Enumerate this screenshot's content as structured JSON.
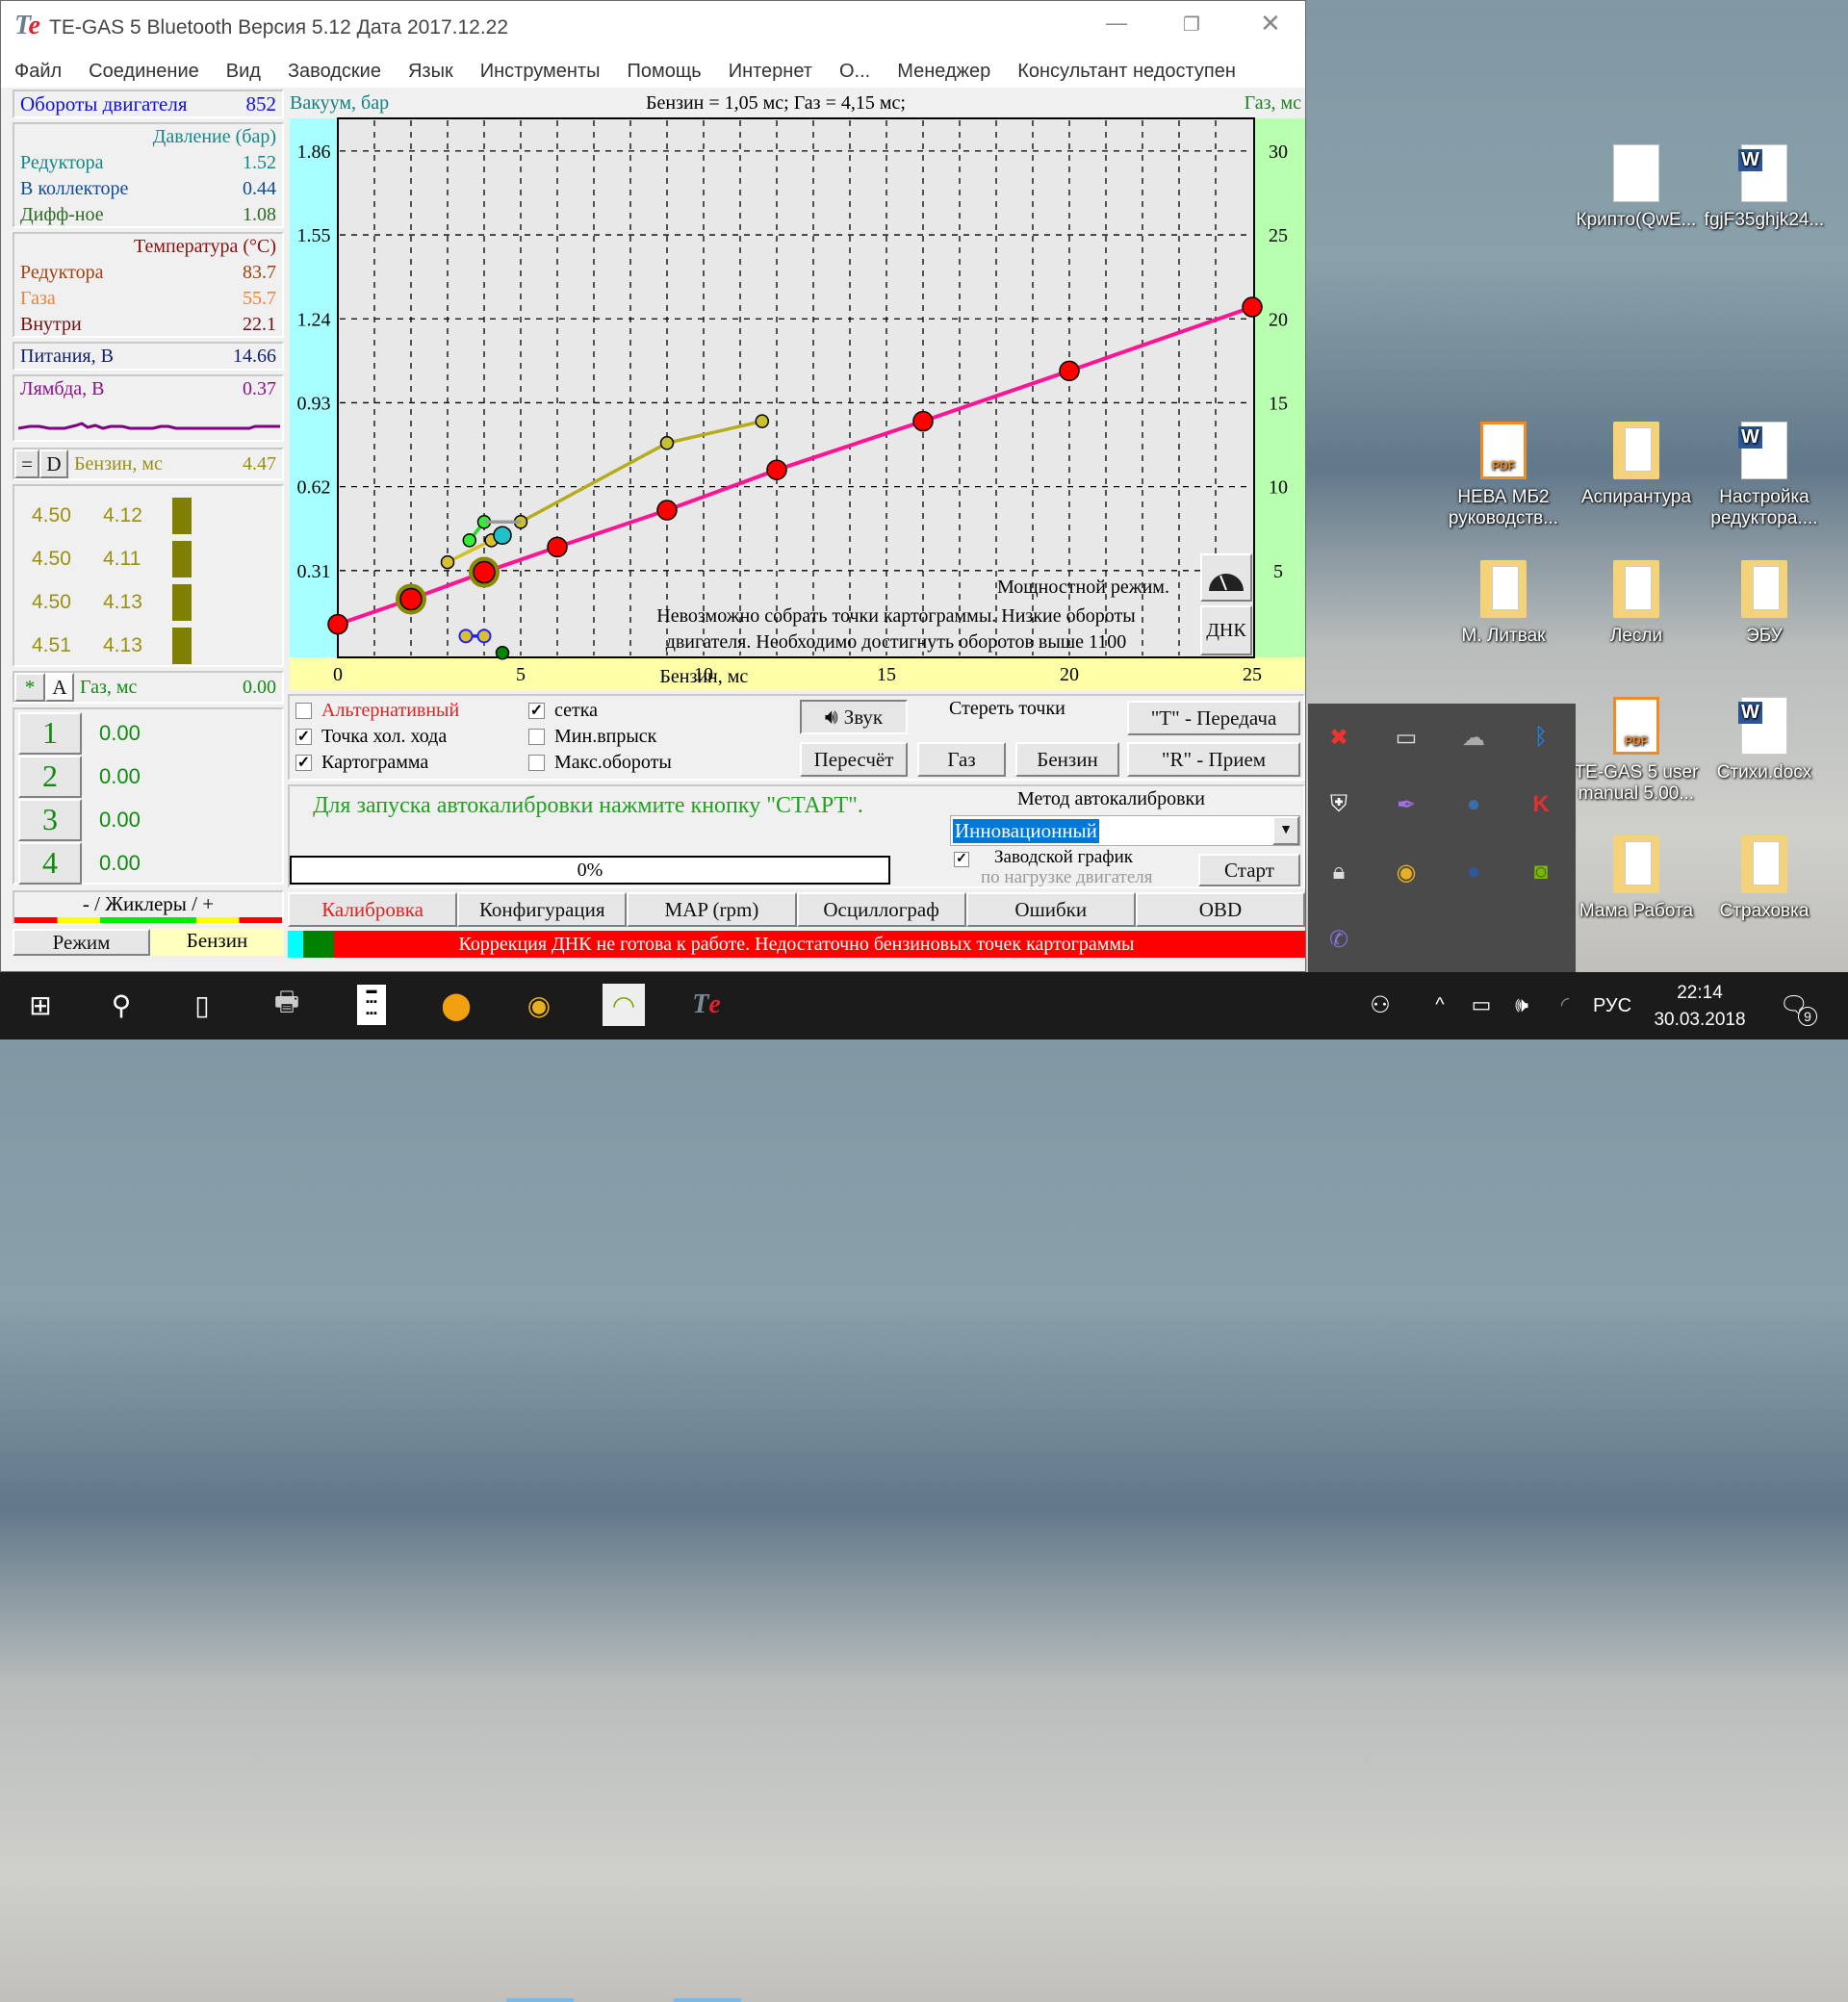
{
  "window": {
    "title": "TE-GAS 5 Bluetooth Версия 5.12  Дата 2017.12.22",
    "logo": "Te"
  },
  "menu": [
    "Файл",
    "Соединение",
    "Вид",
    "Заводские",
    "Язык",
    "Инструменты",
    "Помощь",
    "Интернет",
    "О...",
    "Менеджер",
    "Консультант недоступен"
  ],
  "left": {
    "rpm": {
      "label": "Обороты двигателя",
      "value": "852"
    },
    "pressure": {
      "title": "Давление (бар)",
      "rows": [
        {
          "label": "Редуктора",
          "value": "1.52"
        },
        {
          "label": "В коллекторе",
          "value": "0.44"
        },
        {
          "label": "Дифф-ное",
          "value": "1.08"
        }
      ]
    },
    "temperature": {
      "title": "Температура (°C)",
      "rows": [
        {
          "label": "Редуктора",
          "value": "83.7"
        },
        {
          "label": "Газа",
          "value": "55.7"
        },
        {
          "label": "Внутри",
          "value": "22.1"
        }
      ]
    },
    "supply": {
      "label": "Питания, В",
      "value": "14.66"
    },
    "lambda": {
      "label": "Лямбда, В",
      "value": "0.37"
    },
    "petrol": {
      "btn_eq": "=",
      "btn_d": "D",
      "label": "Бензин, мс",
      "value": "4.47",
      "cylinders": [
        {
          "a": "4.50",
          "b": "4.12"
        },
        {
          "a": "4.50",
          "b": "4.11"
        },
        {
          "a": "4.50",
          "b": "4.13"
        },
        {
          "a": "4.51",
          "b": "4.13"
        }
      ]
    },
    "gas": {
      "btn_star": "*",
      "btn_a": "A",
      "label": "Газ, мс",
      "value": "0.00",
      "injectors": [
        {
          "n": "1",
          "v": "0.00"
        },
        {
          "n": "2",
          "v": "0.00"
        },
        {
          "n": "3",
          "v": "0.00"
        },
        {
          "n": "4",
          "v": "0.00"
        }
      ]
    },
    "jets": "- / Жиклеры / +",
    "mode_label": "Режим",
    "mode_value": "Бензин"
  },
  "chart_data": {
    "type": "line",
    "title": "Бензин = 1,05 мс; Газ = 4,15 мс;",
    "xlabel": "Бензин, мс",
    "ylabel_left": "Вакуум, бар",
    "ylabel_right": "Газ, мс",
    "xlim": [
      0,
      25
    ],
    "ylim": [
      0,
      31.6
    ],
    "x_ticks": [
      0,
      5,
      10,
      15,
      20,
      25
    ],
    "y_ticks": [
      5,
      10,
      15,
      20,
      25,
      30
    ],
    "y_ticks_left": [
      "0.31",
      "0.62",
      "0.93",
      "1.24",
      "1.55",
      "1.86"
    ],
    "grid": true,
    "series": [
      {
        "color": "#ff1493",
        "marker": "#ff0000",
        "points": [
          [
            0,
            1.8
          ],
          [
            2,
            3.3
          ],
          [
            4,
            4.9
          ],
          [
            6,
            6.4
          ],
          [
            9,
            8.6
          ],
          [
            12,
            11.0
          ],
          [
            16,
            13.9
          ],
          [
            20,
            16.9
          ],
          [
            25,
            20.7
          ]
        ],
        "highlight": [
          1,
          2
        ]
      },
      {
        "color": "#b5ac1c",
        "marker": "#c8c030",
        "points": [
          [
            5,
            7.9
          ],
          [
            9,
            12.6
          ],
          [
            11.6,
            13.9
          ]
        ]
      },
      {
        "color": "#d4c020",
        "marker": "#d8c030",
        "points": [
          [
            3,
            5.5
          ],
          [
            4.2,
            6.8
          ]
        ]
      },
      {
        "color": "#22dd22",
        "marker": "#33ee33",
        "points": [
          [
            3.6,
            6.8
          ],
          [
            4,
            7.9
          ]
        ]
      },
      {
        "color": "#999999",
        "marker": null,
        "points": [
          [
            4,
            7.9
          ],
          [
            5,
            7.9
          ]
        ]
      },
      {
        "color": "#2222ff",
        "marker": "#d8c030",
        "ring": "#2222ff",
        "points": [
          [
            3.5,
            1.1
          ],
          [
            4,
            1.1
          ]
        ]
      },
      {
        "color": null,
        "marker": "#20c0c8",
        "points": [
          [
            4.5,
            7.1
          ]
        ]
      },
      {
        "color": null,
        "marker": "#008800",
        "points": [
          [
            4.5,
            0.1
          ]
        ]
      }
    ],
    "annotations": {
      "mode": "Мощностной режим.",
      "line1": "Невозможно собрать точки картограммы. Низкие обороты",
      "line2": "двигателя. Необходимо достигнуть оборотов выше 1100"
    },
    "dnk_button": "ДНК"
  },
  "controls": {
    "checkboxes": [
      {
        "label": "Альтернативный",
        "checked": false
      },
      {
        "label": "Точка хол. хода",
        "checked": true
      },
      {
        "label": "Картограмма",
        "checked": true
      },
      {
        "label": "сетка",
        "checked": true
      },
      {
        "label": "Мин.впрыск",
        "checked": false
      },
      {
        "label": "Макс.обороты",
        "checked": false
      }
    ],
    "sound": "Звук",
    "erase_title": "Стереть точки",
    "recalc": "Пересчёт",
    "gas": "Газ",
    "petrol": "Бензин",
    "transmit": "\"T\" - Передача",
    "receive": "\"R\" - Прием"
  },
  "autocal": {
    "message": "Для запуска автокалибровки нажмите кнопку \"СТАРТ\".",
    "progress": "0%",
    "progress_value": 0,
    "method_title": "Метод автокалибровки",
    "method": "Инновационный",
    "factory": "Заводской график",
    "load": "по нагрузке двигателя",
    "start": "Старт"
  },
  "tabs": [
    "Калибровка",
    "Конфигурация",
    "MAP (rpm)",
    "Осциллограф",
    "Ошибки",
    "OBD"
  ],
  "status": {
    "text": "Коррекция ДНК не готова к работе. Недостаточно бензиновых точек картограммы",
    "color": "#ff0000"
  },
  "desktop": [
    {
      "label": "Крипто(QwE...",
      "icon": "file-icon"
    },
    {
      "label": "fgjF35ghjk24...",
      "icon": "word-icon"
    },
    {
      "label": "НЕВА МБ2 руководств...",
      "icon": "pdf-icon"
    },
    {
      "label": "Аспирантура",
      "icon": "folder-icon"
    },
    {
      "label": "Настройка редуктора....",
      "icon": "word-icon"
    },
    {
      "label": "М. Литвак",
      "icon": "folder-icon"
    },
    {
      "label": "Лесли",
      "icon": "folder-icon"
    },
    {
      "label": "ЭБУ",
      "icon": "folder-icon"
    },
    {
      "label": "TE-GAS 5 user manual 5.00...",
      "icon": "pdf-icon"
    },
    {
      "label": "Стихи.docx",
      "icon": "word-icon"
    },
    {
      "label": "Мама Работа",
      "icon": "folder-icon"
    },
    {
      "label": "Страховка",
      "icon": "folder-icon"
    }
  ],
  "tray_popup": [
    "network-error-icon",
    "display-icon",
    "onedrive-icon",
    "bluetooth-icon",
    "defender-warning-icon",
    "feather-icon",
    "steam-icon",
    "kaspersky-icon",
    "vpn-lock-icon",
    "chrome-icon",
    "globe-icon",
    "nvidia-icon",
    "viber-icon"
  ],
  "taskbar": {
    "apps": [
      "start-icon",
      "search-icon",
      "task-view-icon",
      "device-manager-icon",
      "calculator-icon",
      "aimp-icon",
      "chrome-icon",
      "wifi-app-icon",
      "tegas-icon"
    ],
    "lang": "РУС",
    "time": "22:14",
    "date": "30.03.2018",
    "notifications": "9"
  }
}
